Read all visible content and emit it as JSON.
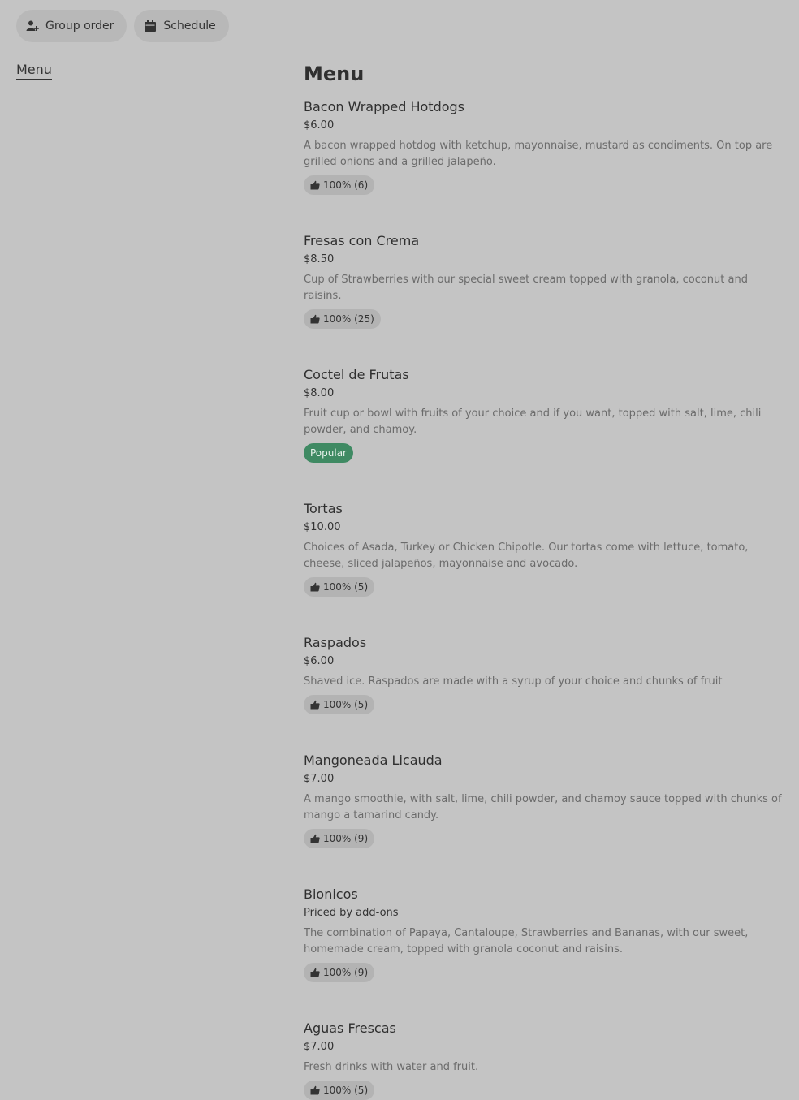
{
  "topbar": {
    "group_order": {
      "label": "Group order",
      "icon": "person-add-icon"
    },
    "schedule": {
      "label": "Schedule",
      "icon": "calendar-icon"
    }
  },
  "sidebar": {
    "menu_link": "Menu"
  },
  "main": {
    "title": "Menu",
    "items": [
      {
        "name": "Bacon Wrapped Hotdogs",
        "price": "$6.00",
        "description": "A bacon wrapped hotdog with ketchup, mayonnaise, mustard as condiments. On top are grilled onions and a grilled jalapeño.",
        "rating": "100% (6)"
      },
      {
        "name": "Fresas con Crema",
        "price": "$8.50",
        "description": "Cup of Strawberries with our special sweet cream topped with granola, coconut and raisins.",
        "rating": "100% (25)"
      },
      {
        "name": "Coctel de Frutas",
        "price": "$8.00",
        "description": "Fruit cup or bowl with fruits of your choice and if you want, topped with salt, lime, chili powder, and chamoy.",
        "badge": "Popular"
      },
      {
        "name": "Tortas",
        "price": "$10.00",
        "description": "Choices of Asada, Turkey or Chicken Chipotle. Our tortas come with lettuce, tomato, cheese, sliced jalapeños, mayonnaise and avocado.",
        "rating": "100% (5)"
      },
      {
        "name": "Raspados",
        "price": "$6.00",
        "description": "Shaved ice. Raspados are made with a syrup of your choice and chunks of fruit",
        "rating": "100% (5)"
      },
      {
        "name": "Mangoneada Licauda",
        "price": "$7.00",
        "description": "A mango smoothie, with salt, lime, chili powder, and chamoy sauce topped with chunks of mango a tamarind candy.",
        "rating": "100% (9)"
      },
      {
        "name": "Bionicos",
        "price": "Priced by add-ons",
        "description": "The combination of Papaya, Cantaloupe, Strawberries and Bananas, with our sweet, homemade cream, topped with granola coconut and raisins.",
        "rating": "100% (9)"
      },
      {
        "name": "Aguas Frescas",
        "price": "$7.00",
        "description": "Fresh drinks with water and fruit.",
        "rating": "100% (5)"
      }
    ]
  },
  "colors": {
    "background": "#c4c4c4",
    "popular_badge": "#3f8a63"
  }
}
